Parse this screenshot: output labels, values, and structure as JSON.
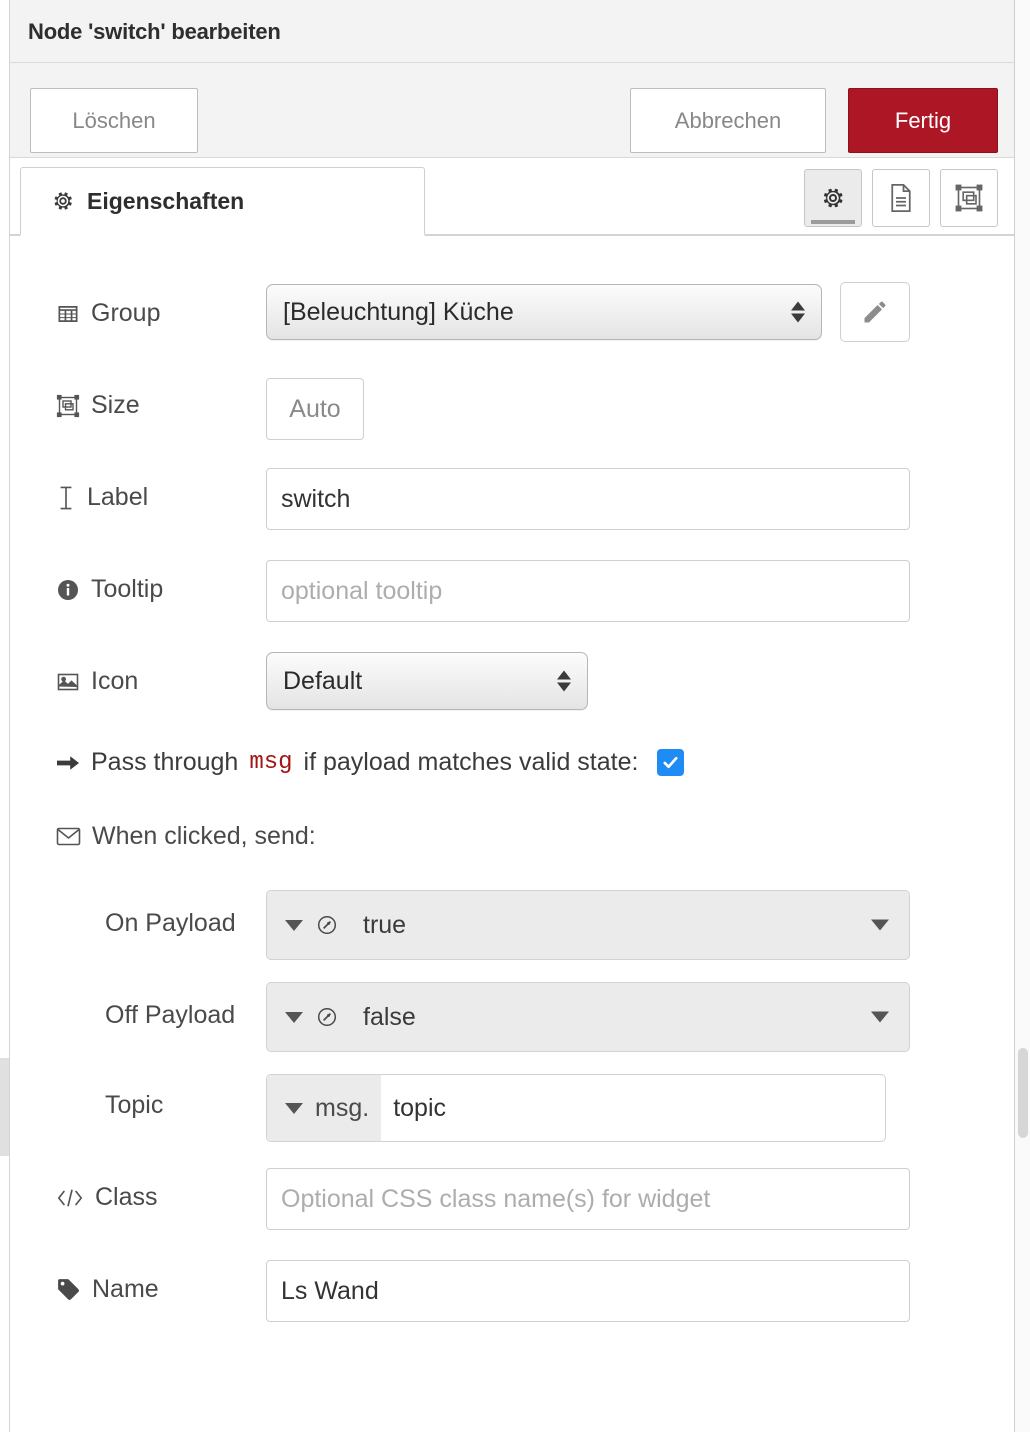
{
  "window": {
    "title": "Node 'switch' bearbeiten"
  },
  "colors": {
    "done_button_bg": "#ad1625",
    "checkbox_blue": "#1f8bf5",
    "code_red": "#a31515",
    "chrome_grey": "#f3f3f3"
  },
  "toolbar": {
    "delete_label": "Löschen",
    "cancel_label": "Abbrechen",
    "done_label": "Fertig"
  },
  "tabs": {
    "properties_label": "Eigenschaften",
    "tools": [
      {
        "name": "properties",
        "icon": "gear-icon",
        "active": true
      },
      {
        "name": "description",
        "icon": "document-icon",
        "active": false
      },
      {
        "name": "appearance",
        "icon": "appearance-icon",
        "active": false
      }
    ]
  },
  "form": {
    "group": {
      "label": "Group",
      "icon": "table-icon",
      "value": "[Beleuchtung] Küche",
      "edit_button_icon": "pencil-icon"
    },
    "size": {
      "label": "Size",
      "icon": "resize-icon",
      "value": "Auto"
    },
    "label_field": {
      "label": "Label",
      "icon": "text-cursor-icon",
      "value": "switch"
    },
    "tooltip": {
      "label": "Tooltip",
      "icon": "info-icon",
      "value": "",
      "placeholder": "optional tooltip"
    },
    "icon_field": {
      "label": "Icon",
      "icon": "image-icon",
      "value": "Default"
    },
    "passthrough": {
      "icon": "arrow-right-icon",
      "text_before": "Pass through",
      "code": "msg",
      "text_after": "if payload matches valid state:",
      "checked": true
    },
    "when_clicked": {
      "icon": "envelope-icon",
      "text": "When clicked, send:"
    },
    "on_payload": {
      "label": "On Payload",
      "type_icon": "boolean-icon",
      "value": "true"
    },
    "off_payload": {
      "label": "Off Payload",
      "type_icon": "boolean-icon",
      "value": "false"
    },
    "topic": {
      "label": "Topic",
      "prefix": "msg.",
      "value": "topic"
    },
    "css_class": {
      "label": "Class",
      "icon": "code-icon",
      "value": "",
      "placeholder": "Optional CSS class name(s) for widget"
    },
    "name": {
      "label": "Name",
      "icon": "tag-icon",
      "value": "Ls Wand"
    }
  }
}
